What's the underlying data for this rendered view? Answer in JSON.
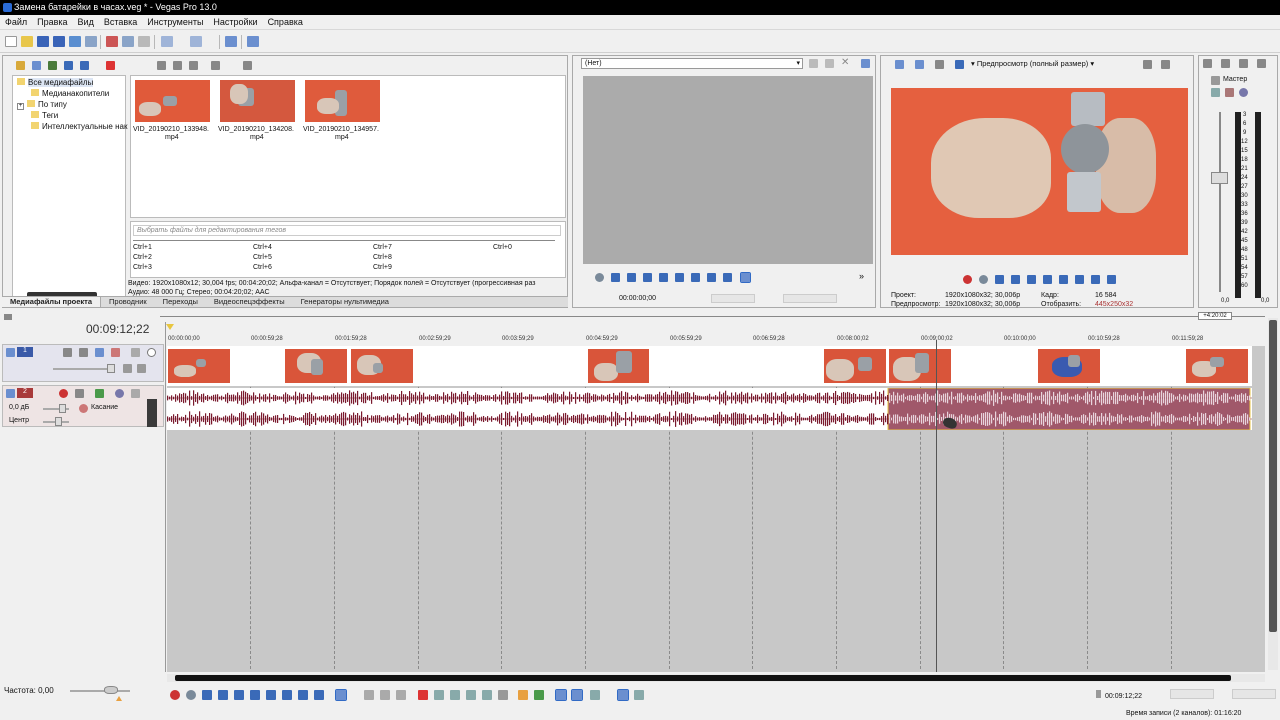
{
  "window": {
    "title": "Замена батарейки в часах.veg * - Vegas Pro 13.0"
  },
  "menu": [
    "Файл",
    "Правка",
    "Вид",
    "Вставка",
    "Инструменты",
    "Настройки",
    "Справка"
  ],
  "explorer": {
    "tree": [
      {
        "label": "Все медиафайлы"
      },
      {
        "label": "Медианакопители"
      },
      {
        "label": "По типу"
      },
      {
        "label": "Теги"
      },
      {
        "label": "Интеллектуальные нак"
      }
    ],
    "media": [
      {
        "name": "VID_20190210_133948.",
        "ext": "mp4"
      },
      {
        "name": "VID_20190210_134208.",
        "ext": "mp4"
      },
      {
        "name": "VID_20190210_134957.",
        "ext": "mp4"
      }
    ],
    "tag_placeholder": "Выбрать файлы для редактирования тегов",
    "shortcuts": [
      "Ctrl+1",
      "Ctrl+4",
      "Ctrl+7",
      "Ctrl+0",
      "Ctrl+2",
      "Ctrl+5",
      "Ctrl+8",
      "Ctrl+3",
      "Ctrl+6",
      "Ctrl+9"
    ],
    "info_video": "Видео: 1920x1080x12; 30,004 fps; 00:04:20;02; Альфа-канал = Отсутствует; Порядок полей = Отсутствует (прогрессивная раз",
    "info_audio": "Аудио: 48 000 Гц; Стерео; 00:04:20;02; AAC",
    "tabs": [
      "Медиафайлы проекта",
      "Проводник",
      "Переходы",
      "Видеоспецэффекты",
      "Генераторы нультимедиа"
    ]
  },
  "trimmer": {
    "selector": "(Нет)",
    "time": "00:00:00;00"
  },
  "preview": {
    "mode": "Предпросмотр (полный размер)",
    "labels": {
      "project": "Проект:",
      "preview": "Предпросмотр:",
      "frame": "Кадр:",
      "display": "Отобразить:"
    },
    "project": "1920x1080x32; 30,006p",
    "preview": "1920x1080x32; 30,006p",
    "frame": "16 584",
    "display": "445x250x32"
  },
  "master": {
    "title": "Мастер",
    "scale": [
      "3",
      "6",
      "9",
      "12",
      "15",
      "18",
      "21",
      "24",
      "27",
      "30",
      "33",
      "36",
      "39",
      "42",
      "45",
      "48",
      "51",
      "54",
      "57",
      "60"
    ],
    "left_val": "0,0",
    "right_val": "0,0"
  },
  "timeline": {
    "cursor_time": "00:09:12;22",
    "end_marker": "+4:20:02",
    "ruler": [
      "00:00:00;00",
      "00:00:59;28",
      "00:01:59;28",
      "00:02:59;29",
      "00:03:59;29",
      "00:04:59;29",
      "00:05:59;29",
      "00:06:59;28",
      "00:08:00;02",
      "00:09:00;02",
      "00:10:00;00",
      "00:10:59;28",
      "00:11:59;28"
    ],
    "audio_track": {
      "volume": "0,0 дБ",
      "mode": "Касание",
      "pan": "Центр"
    },
    "rate": "Частота: 0,00"
  },
  "transport": {
    "time": "00:09:12;22",
    "record_time": "Время записи (2 каналов): 01:16:20"
  },
  "colors": {
    "accent": "#316ac5",
    "clip": "#d9553a",
    "wave": "#7a1a2e",
    "wave_sel": "#a0586a"
  }
}
